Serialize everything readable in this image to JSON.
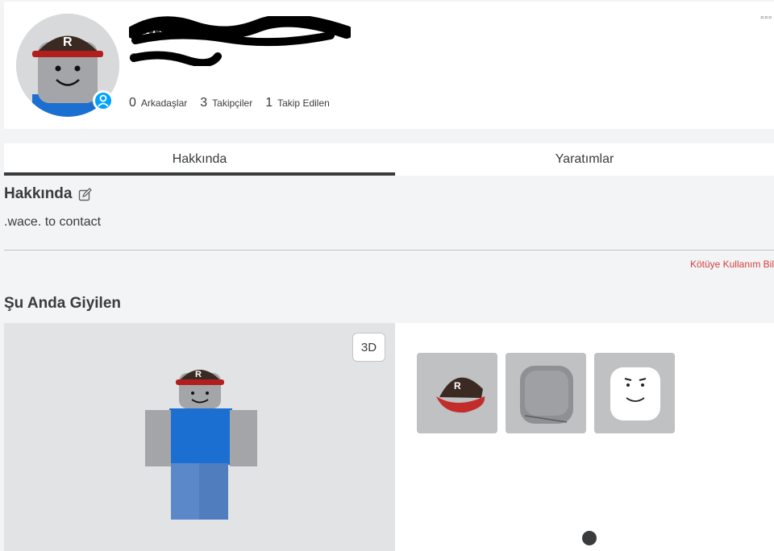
{
  "profile": {
    "display_name": "••••••••",
    "username": "@••••••",
    "more_label": "▫▫▫"
  },
  "stats": [
    {
      "count": "0",
      "label": "Arkadaşlar"
    },
    {
      "count": "3",
      "label": "Takipçiler"
    },
    {
      "count": "1",
      "label": "Takip Edilen"
    }
  ],
  "tabs": [
    {
      "label": "Hakkında",
      "active": true
    },
    {
      "label": "Yaratımlar",
      "active": false
    }
  ],
  "about": {
    "title": "Hakkında",
    "text": ".wace. to contact",
    "report_label": "Kötüye Kullanım Bil"
  },
  "wearing": {
    "title": "Şu Anda Giyilen",
    "toggle_label": "3D",
    "items": [
      {
        "icon": "cap-icon"
      },
      {
        "icon": "head-icon"
      },
      {
        "icon": "face-icon"
      }
    ]
  },
  "colors": {
    "accent": "#00a2ff",
    "report": "#d63f3f",
    "tab_underline": "#393b3d"
  }
}
